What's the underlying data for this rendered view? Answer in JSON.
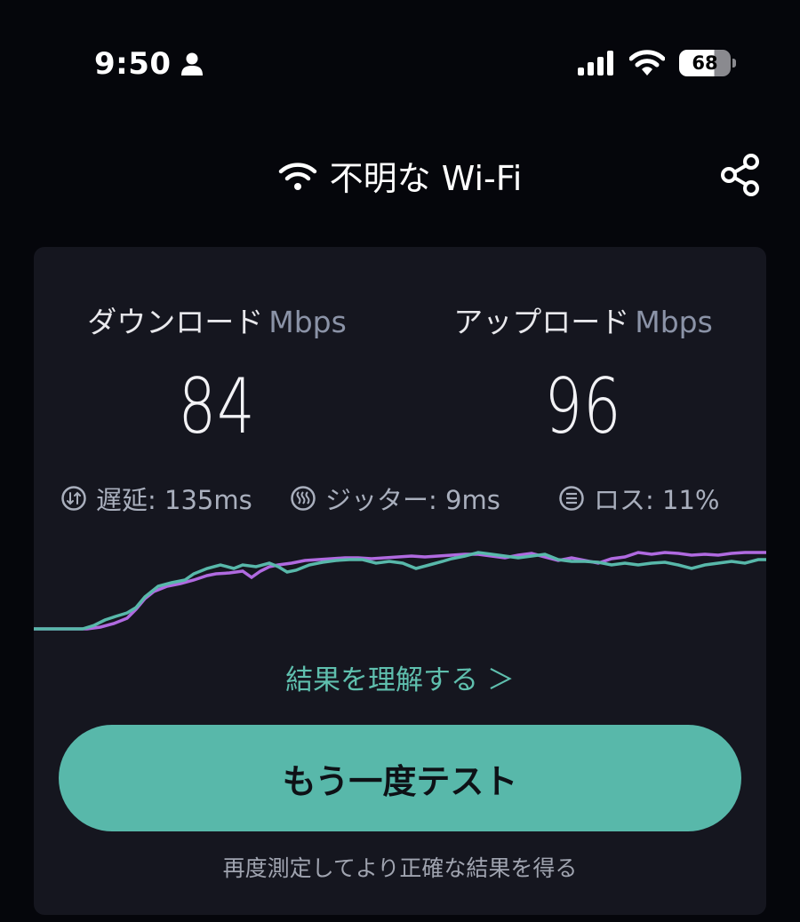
{
  "status_bar": {
    "time": "9:50",
    "battery": "68"
  },
  "header": {
    "network_name": "不明な Wi-Fi"
  },
  "download": {
    "label": "ダウンロード",
    "unit": "Mbps",
    "value": "84"
  },
  "upload": {
    "label": "アップロード",
    "unit": "Mbps",
    "value": "96"
  },
  "stats": {
    "latency": "遅延: 135ms",
    "jitter": "ジッター: 9ms",
    "loss": "ロス: 11%"
  },
  "actions": {
    "understand_link": "結果を理解する ＞",
    "retest_button": "もう一度テスト",
    "remeasure_hint": "再度測定してより正確な結果を得る"
  },
  "colors": {
    "accent": "#58b8aa",
    "download_line": "#58b8aa",
    "upload_line": "#b06ae0",
    "card_bg": "#15161f"
  }
}
